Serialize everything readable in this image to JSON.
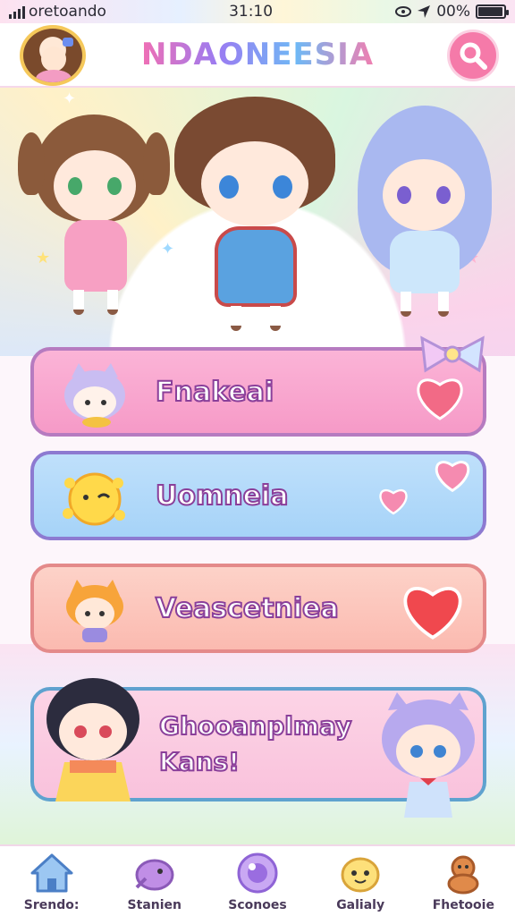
{
  "status_bar": {
    "carrier": "oretoando",
    "time": "31:10",
    "battery": "00%",
    "battery_level": 0.95
  },
  "header": {
    "title": "NDAONEESIA",
    "avatar_icon": "avatar-icon",
    "search_icon": "search-icon"
  },
  "menu": {
    "items": [
      {
        "label": "Fnakeai",
        "icon": "cat-mascot-icon",
        "color": "#f69ac7"
      },
      {
        "label": "Uomneia",
        "icon": "sun-mascot-icon",
        "color": "#a6d3f8"
      },
      {
        "label": "Veascetniea",
        "icon": "cat-kid-icon",
        "color": "#fbbab0"
      },
      {
        "label_line1": "Ghooanplmay",
        "label_line2": "Kans!",
        "color": "#f9c2dc"
      }
    ]
  },
  "bottom_nav": {
    "items": [
      {
        "label": "Srendo:",
        "icon": "home-icon"
      },
      {
        "label": "Stanien",
        "icon": "bird-icon"
      },
      {
        "label": "Sconoes",
        "icon": "orb-icon"
      },
      {
        "label": "Galialy",
        "icon": "smiley-icon"
      },
      {
        "label": "Fhetooie",
        "icon": "cookie-icon"
      }
    ]
  },
  "colors": {
    "accent_pink": "#f57aa9",
    "title_gradient": [
      "#f06fb4",
      "#9a7cf2",
      "#6fb8f5"
    ]
  }
}
